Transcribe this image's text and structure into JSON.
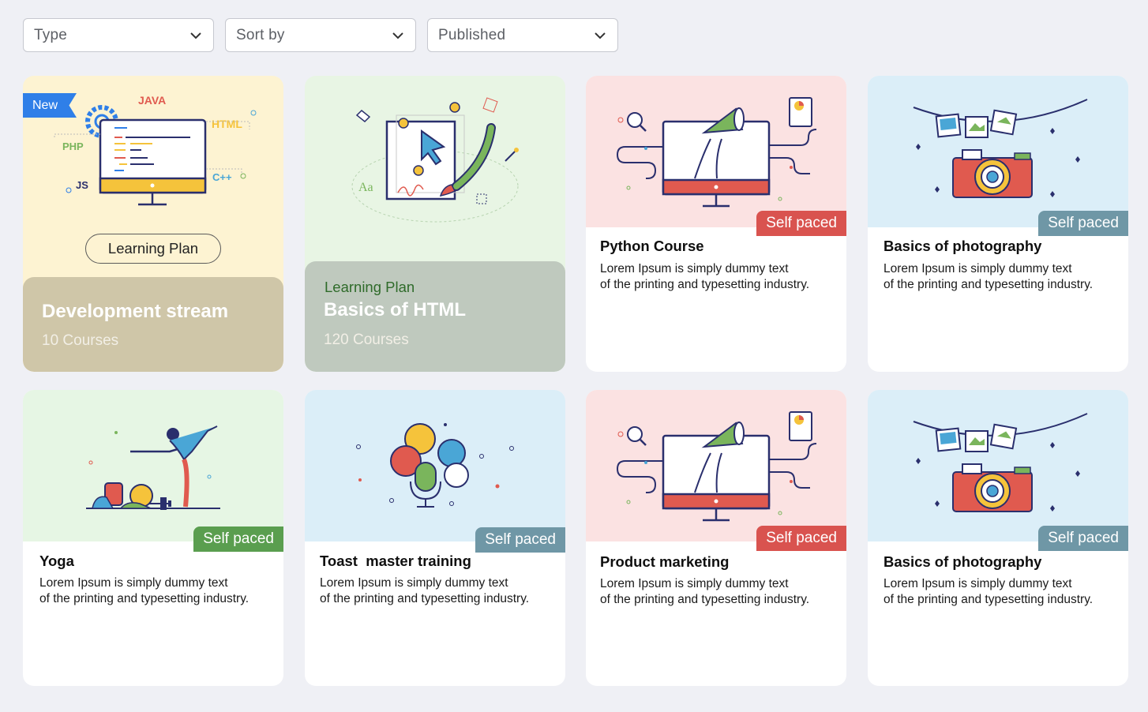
{
  "filters": [
    {
      "label": "Type"
    },
    {
      "label": "Sort by"
    },
    {
      "label": "Published"
    }
  ],
  "plans": [
    {
      "tag": "",
      "badge": "New",
      "button": "Learning Plan",
      "title": "Development stream",
      "count": "10 Courses",
      "art_labels": {
        "java": "JAVA",
        "html": "HTML",
        "php": "PHP",
        "js": "JS",
        "cpp": "C++"
      }
    },
    {
      "tag": "Learning Plan",
      "title": "Basics of HTML",
      "count": "120 Courses",
      "art_labels": {
        "aa": "Aa"
      }
    }
  ],
  "courses": [
    {
      "title": "Python Course",
      "badge": "Self paced",
      "desc_line1": "Lorem Ipsum is simply dummy text",
      "desc_line2": "of the printing and typesetting industry."
    },
    {
      "title": "Basics of photography",
      "badge": "Self paced",
      "desc_line1": "Lorem Ipsum is simply dummy text",
      "desc_line2": "of the printing and typesetting industry."
    },
    {
      "title": "Yoga",
      "badge": "Self paced",
      "desc_line1": "Lorem Ipsum is simply dummy text",
      "desc_line2": "of the printing and typesetting industry."
    },
    {
      "title": "Toast  master training",
      "badge": "Self paced",
      "desc_line1": "Lorem Ipsum is simply dummy text",
      "desc_line2": "of the printing and typesetting industry."
    },
    {
      "title": "Product marketing",
      "badge": "Self paced",
      "desc_line1": "Lorem Ipsum is simply dummy text",
      "desc_line2": "of the printing and typesetting industry."
    },
    {
      "title": "Basics of photography",
      "badge": "Self paced",
      "desc_line1": "Lorem Ipsum is simply dummy text",
      "desc_line2": "of the printing and typesetting industry."
    }
  ],
  "colors": {
    "badge_red": "#d9534f",
    "badge_slate": "#6f97a6",
    "badge_green": "#5a9e4f",
    "plan_dev_bg": "#fdf3d2",
    "plan_dev_footer": "#cfc6a8",
    "plan_html_bg": "#e8f5e4",
    "plan_html_footer": "#bfc9be"
  }
}
